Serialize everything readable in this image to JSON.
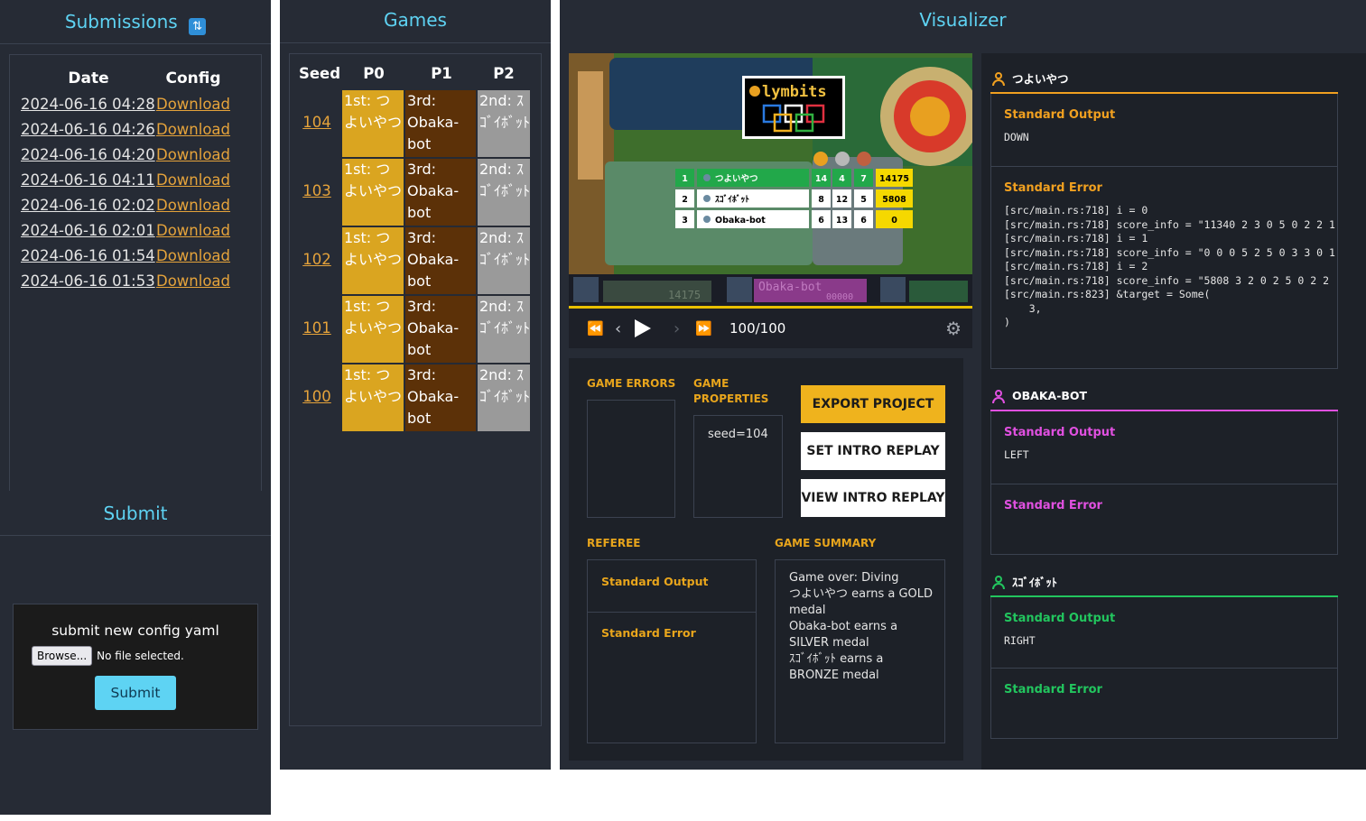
{
  "submissions": {
    "title": "Submissions",
    "refresh_icon": "refresh-icon",
    "headers": [
      "Date",
      "Config"
    ],
    "rows": [
      {
        "date": "2024-06-16 04:28",
        "config": "Download"
      },
      {
        "date": "2024-06-16 04:26",
        "config": "Download"
      },
      {
        "date": "2024-06-16 04:20",
        "config": "Download"
      },
      {
        "date": "2024-06-16 04:11",
        "config": "Download"
      },
      {
        "date": "2024-06-16 02:02",
        "config": "Download"
      },
      {
        "date": "2024-06-16 02:01",
        "config": "Download"
      },
      {
        "date": "2024-06-16 01:54",
        "config": "Download"
      },
      {
        "date": "2024-06-16 01:53",
        "config": "Download"
      }
    ]
  },
  "submit": {
    "title": "Submit",
    "label": "submit new config yaml",
    "browse": "Browse...",
    "no_file": "No file selected.",
    "button": "Submit"
  },
  "games": {
    "title": "Games",
    "headers": [
      "Seed",
      "P0",
      "P1",
      "P2"
    ],
    "rows": [
      {
        "seed": "104",
        "p0": "1st: つよいやつ",
        "p1": "3rd: Obaka-bot",
        "p2": "2nd: ｽｺﾞｲﾎﾞｯﾄ"
      },
      {
        "seed": "103",
        "p0": "1st: つよいやつ",
        "p1": "3rd: Obaka-bot",
        "p2": "2nd: ｽｺﾞｲﾎﾞｯﾄ"
      },
      {
        "seed": "102",
        "p0": "1st: つよいやつ",
        "p1": "3rd: Obaka-bot",
        "p2": "2nd: ｽｺﾞｲﾎﾞｯﾄ"
      },
      {
        "seed": "101",
        "p0": "1st: つよいやつ",
        "p1": "3rd: Obaka-bot",
        "p2": "2nd: ｽｺﾞｲﾎﾞｯﾄ"
      },
      {
        "seed": "100",
        "p0": "1st: つよいやつ",
        "p1": "3rd: Obaka-bot",
        "p2": "2nd: ｽｺﾞｲﾎﾞｯﾄ"
      }
    ],
    "colors": {
      "first": "#daa520",
      "third": "#5c3108",
      "second": "#9a9a9a"
    }
  },
  "visualizer": {
    "title": "Visualizer",
    "logo": "lymbits",
    "scoreboard": [
      {
        "rank": "1",
        "name": "つよいやつ",
        "g": "14",
        "s": "4",
        "b": "7",
        "score": "14175"
      },
      {
        "rank": "2",
        "name": "ｽｺﾞｲﾎﾞｯﾄ",
        "g": "8",
        "s": "12",
        "b": "5",
        "score": "5808"
      },
      {
        "rank": "3",
        "name": "Obaka-bot",
        "g": "6",
        "s": "13",
        "b": "6",
        "score": "0"
      }
    ],
    "bottom_bar": {
      "score_left": "14175",
      "name_mid": "Obaka-bot",
      "score_mid": "00000"
    },
    "frame": "100/100",
    "progress": 1.0,
    "game_errors_label": "GAME ERRORS",
    "game_properties_label": "GAME PROPERTIES",
    "game_properties_value": "seed=104",
    "export_button": "EXPORT PROJECT",
    "set_intro_button": "SET INTRO REPLAY",
    "view_intro_button": "VIEW INTRO REPLAY",
    "referee_label": "REFEREE",
    "referee_stdout": "Standard Output",
    "referee_stderr": "Standard Error",
    "summary_label": "GAME SUMMARY",
    "summary_lines": [
      "Game over: Diving",
      "つよいやつ earns a GOLD",
      "medal",
      "Obaka-bot earns a",
      "SILVER medal",
      "ｽｺﾞｲﾎﾞｯﾄ earns a",
      "BRONZE medal"
    ]
  },
  "players": [
    {
      "name": "つよいやつ",
      "color": "#f0a020",
      "stdout_label": "Standard Output",
      "stdout": "DOWN",
      "stderr_label": "Standard Error",
      "stderr": "[src/main.rs:718] i = 0\n[src/main.rs:718] score_info = \"11340 2 3 0 5 0 2 2 1\n[src/main.rs:718] i = 1\n[src/main.rs:718] score_info = \"0 0 0 5 2 5 0 3 3 0 1\n[src/main.rs:718] i = 2\n[src/main.rs:718] score_info = \"5808 3 2 0 2 5 0 2 2\n[src/main.rs:823] &target = Some(\n    3,\n)"
    },
    {
      "name": "OBAKA-BOT",
      "color": "#e050e0",
      "stdout_label": "Standard Output",
      "stdout": "LEFT",
      "stderr_label": "Standard Error",
      "stderr": ""
    },
    {
      "name": "ｽｺﾞｲﾎﾞｯﾄ",
      "color": "#22c55e",
      "stdout_label": "Standard Output",
      "stdout": "RIGHT",
      "stderr_label": "Standard Error",
      "stderr": ""
    }
  ]
}
